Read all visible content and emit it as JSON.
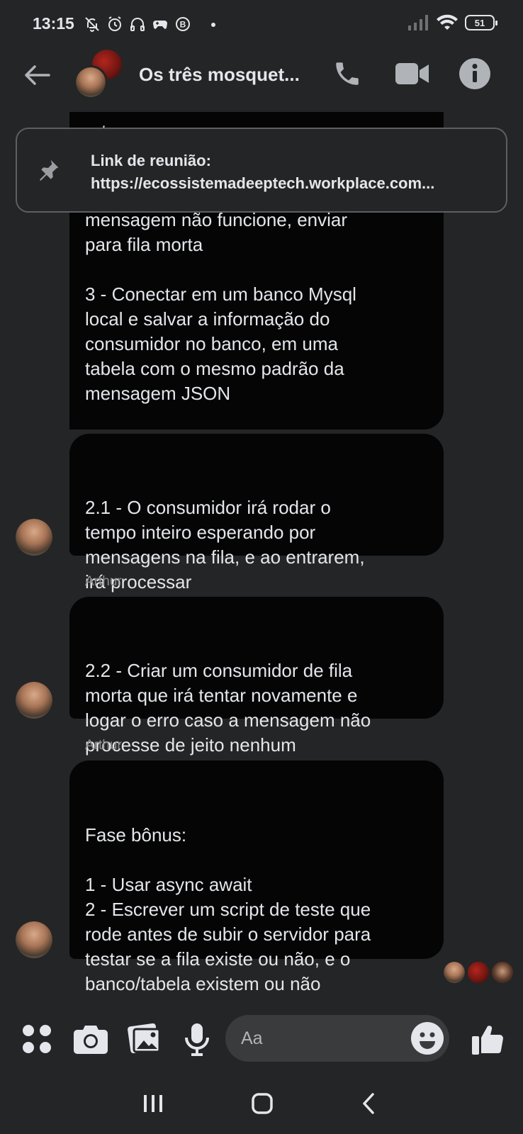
{
  "status_bar": {
    "time": "13:15",
    "battery": "51"
  },
  "header": {
    "title": "Os três mosquet..."
  },
  "pinned": {
    "title": "Link de reunião:",
    "link": "https://ecossistemadeeptech.workplace.com..."
  },
  "messages": [
    {
      "text_top_partial": "mensagem não funcione, enviar\npara fila morta\n\n3 - Conectar em um banco Mysql\nlocal e salvar a informação do\nconsumidor no banco, em uma\ntabela com o mesmo padrão da\nmensagem JSON"
    },
    {
      "text": "2.1 - O consumidor irá rodar o\ntempo inteiro esperando por\nmensagens na fila, e ao entrarem,\nirá processar"
    },
    {
      "sender": "Arthur",
      "text": "2.2 - Criar um consumidor de fila\nmorta que irá tentar novamente e\nlogar o erro caso a mensagem não\nprocesse de jeito nenhum"
    },
    {
      "sender": "Arthur",
      "text": "Fase bônus:\n\n1 - Usar async await\n2 - Escrever um script de teste que\nrode antes de subir o servidor para\ntestar se a fila existe ou não, e o\nbanco/tabela existem ou não"
    }
  ],
  "hidden_top_fragment": "retornar erro",
  "composer": {
    "placeholder": "Aa"
  },
  "icons": {
    "back": "arrow-left-icon",
    "call": "phone-icon",
    "video": "video-camera-icon",
    "info": "info-icon",
    "pin": "pin-icon",
    "menu": "four-dots-icon",
    "camera": "camera-icon",
    "gallery": "gallery-icon",
    "mic": "microphone-icon",
    "emoji": "emoji-icon",
    "like": "thumbs-up-icon"
  },
  "colors": {
    "background": "#242526",
    "bubble": "#050505",
    "text": "#e4e6eb",
    "muted": "#8a8d91"
  }
}
